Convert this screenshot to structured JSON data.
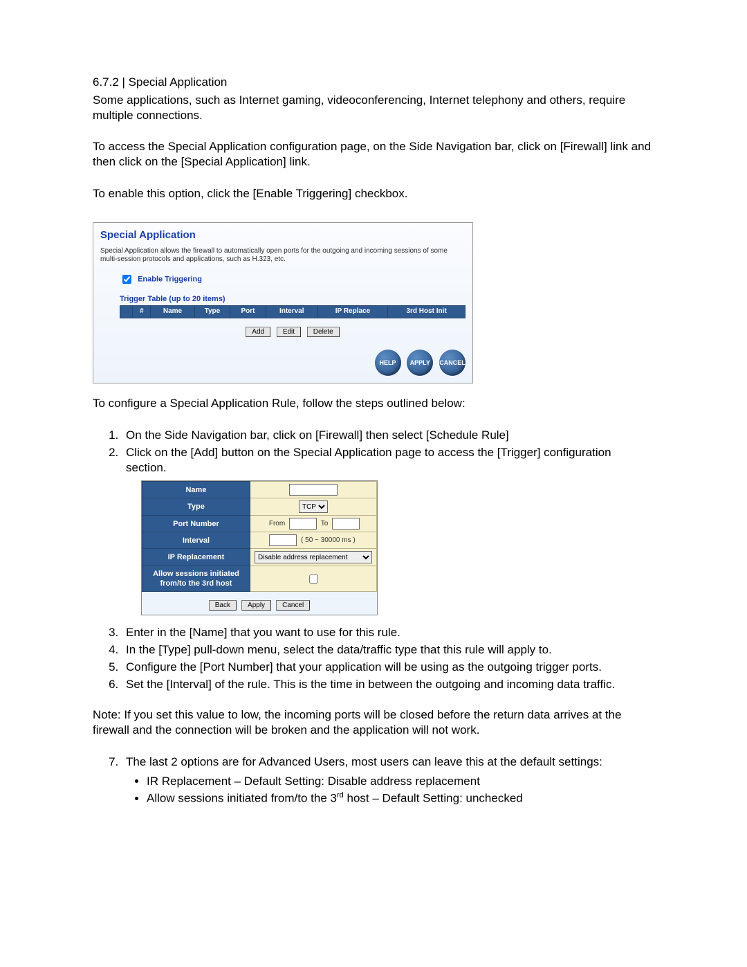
{
  "heading": "6.7.2  |  Special Application",
  "intro1": "Some applications, such as Internet gaming, videoconferencing, Internet telephony and others, require multiple connections.",
  "intro2": "To access the Special Application configuration page, on the Side Navigation bar, click on [Firewall] link and then click on the [Special Application] link.",
  "intro3": "To enable this option, click the [Enable Triggering] checkbox.",
  "shot1": {
    "title": "Special Application",
    "desc": "Special Application allows the firewall to automatically open ports for the outgoing and incoming sessions of some multi-session protocols and applications, such as H.323, etc.",
    "enable_label": "Enable Triggering",
    "table_title": "Trigger Table (up to 20 items)",
    "cols": [
      "#",
      "Name",
      "Type",
      "Port",
      "Interval",
      "IP Replace",
      "3rd Host Init"
    ],
    "add": "Add",
    "edit": "Edit",
    "del": "Delete",
    "help": "HELP",
    "apply": "APPLY",
    "cancel": "CANCEL"
  },
  "after1": "To configure a Special Application Rule, follow the steps outlined below:",
  "step1": "On the Side Navigation bar, click on [Firewall] then select [Schedule Rule]",
  "step2": "Click on the [Add] button on the Special Application page to access the [Trigger] configuration section.",
  "form": {
    "name": "Name",
    "type": "Type",
    "type_value": "TCP",
    "port": "Port Number",
    "from": "From",
    "to": "To",
    "interval": "Interval",
    "interval_hint": "( 50 ~ 30000 ms )",
    "iprep": "IP Replacement",
    "iprep_value": "Disable address replacement",
    "allow3rd_a": "Allow sessions initiated",
    "allow3rd_b": "from/to the 3rd host",
    "back": "Back",
    "apply": "Apply",
    "cancel": "Cancel"
  },
  "step3": "Enter in the [Name] that you want to use for this rule.",
  "step4": "In the [Type] pull-down menu, select the data/traffic type that this rule will apply to.",
  "step5": "Configure the [Port Number] that your application will be using as the outgoing trigger ports.",
  "step6": "Set the [Interval] of the rule.  This is the time in between the outgoing and incoming data traffic.",
  "note": "Note:  If you set this value to low, the incoming ports will be closed before the return data arrives at the firewall and the connection will be broken and the application will not work.",
  "step7": "The last 2 options are for Advanced Users, most users can leave this at the default settings:",
  "bul1": "IR Replacement – Default Setting: Disable address replacement",
  "bul2_a": "Allow sessions initiated from/to the 3",
  "bul2_b": " host – Default Setting: unchecked"
}
